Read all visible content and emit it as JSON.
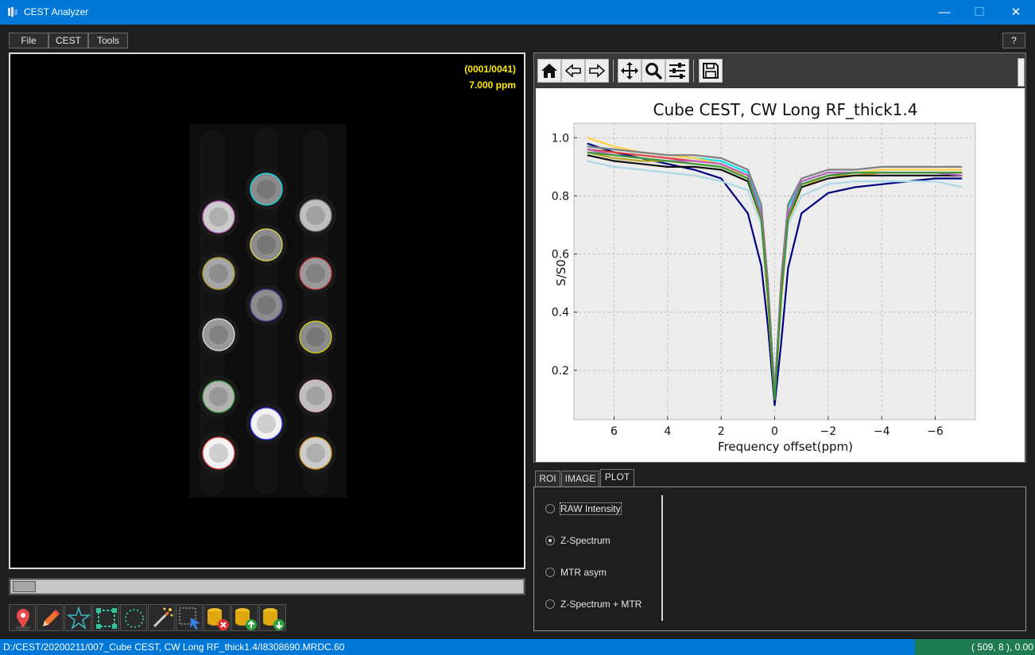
{
  "window": {
    "title": "CEST Analyzer",
    "minimize": "—",
    "maximize": "☐",
    "close": "✕"
  },
  "menu": {
    "file": "File",
    "cest": "CEST",
    "tools": "Tools",
    "help": "?"
  },
  "image_view": {
    "frame_counter": "(0001/0041)",
    "offset_label": "7.000 ppm"
  },
  "slider": {
    "position": 0.0,
    "frame": 1,
    "total": 41
  },
  "bottom_tools": [
    "roi-pin-icon",
    "pencil-icon",
    "star-polygon-icon",
    "square-roi-icon",
    "circle-roi-icon",
    "magic-wand-icon",
    "select-arrow-icon",
    "delete-roi-icon",
    "upload-roi-icon",
    "download-roi-icon"
  ],
  "plot_toolbar": [
    "home-icon",
    "back-icon",
    "forward-icon",
    "pan-icon",
    "zoom-icon",
    "configure-icon",
    "save-icon"
  ],
  "chart_data": {
    "type": "line",
    "title": "Cube CEST, CW Long RF_thick1.4",
    "xlabel": "Frequency offset(ppm)",
    "ylabel": "S/S0",
    "xlim": [
      7.5,
      -7.5
    ],
    "ylim": [
      0.03,
      1.05
    ],
    "x_inverted": true,
    "grid": true,
    "xticks": [
      "6",
      "4",
      "2",
      "0",
      "−2",
      "−4",
      "−6"
    ],
    "yticks": [
      "0.2",
      "0.4",
      "0.6",
      "0.8",
      "1.0"
    ],
    "x": [
      7,
      6,
      5,
      4,
      3,
      2,
      1,
      0.5,
      0.25,
      0,
      -0.25,
      -0.5,
      -1,
      -2,
      -3,
      -4,
      -5,
      -6,
      -7
    ],
    "series": [
      {
        "color": "#000080",
        "values": [
          0.98,
          0.95,
          0.93,
          0.91,
          0.89,
          0.86,
          0.74,
          0.56,
          0.35,
          0.08,
          0.3,
          0.55,
          0.74,
          0.81,
          0.83,
          0.84,
          0.85,
          0.86,
          0.86
        ]
      },
      {
        "color": "#00e5ee",
        "values": [
          0.97,
          0.96,
          0.95,
          0.94,
          0.93,
          0.92,
          0.88,
          0.75,
          0.5,
          0.12,
          0.52,
          0.76,
          0.85,
          0.88,
          0.88,
          0.88,
          0.88,
          0.88,
          0.87
        ]
      },
      {
        "color": "#ffd24a",
        "values": [
          1.0,
          0.97,
          0.95,
          0.94,
          0.93,
          0.91,
          0.86,
          0.7,
          0.42,
          0.1,
          0.44,
          0.7,
          0.83,
          0.87,
          0.88,
          0.89,
          0.89,
          0.89,
          0.89
        ]
      },
      {
        "color": "#add8e6",
        "values": [
          0.92,
          0.9,
          0.89,
          0.88,
          0.87,
          0.85,
          0.82,
          0.7,
          0.45,
          0.15,
          0.46,
          0.7,
          0.8,
          0.84,
          0.85,
          0.85,
          0.85,
          0.85,
          0.83
        ]
      },
      {
        "color": "#808080",
        "values": [
          0.97,
          0.96,
          0.95,
          0.94,
          0.94,
          0.93,
          0.89,
          0.77,
          0.5,
          0.12,
          0.52,
          0.77,
          0.86,
          0.89,
          0.89,
          0.9,
          0.9,
          0.9,
          0.9
        ]
      },
      {
        "color": "#e04040",
        "values": [
          0.96,
          0.95,
          0.94,
          0.93,
          0.92,
          0.91,
          0.87,
          0.74,
          0.47,
          0.11,
          0.48,
          0.74,
          0.84,
          0.87,
          0.88,
          0.88,
          0.88,
          0.88,
          0.88
        ]
      },
      {
        "color": "#b8a020",
        "values": [
          0.95,
          0.93,
          0.92,
          0.92,
          0.91,
          0.9,
          0.86,
          0.73,
          0.46,
          0.1,
          0.47,
          0.73,
          0.84,
          0.87,
          0.87,
          0.88,
          0.88,
          0.88,
          0.88
        ]
      },
      {
        "color": "#101010",
        "values": [
          0.94,
          0.92,
          0.91,
          0.9,
          0.9,
          0.89,
          0.85,
          0.72,
          0.45,
          0.1,
          0.46,
          0.72,
          0.83,
          0.86,
          0.87,
          0.87,
          0.87,
          0.87,
          0.87
        ]
      },
      {
        "color": "#c060c0",
        "values": [
          0.96,
          0.94,
          0.93,
          0.92,
          0.92,
          0.91,
          0.87,
          0.74,
          0.46,
          0.11,
          0.47,
          0.74,
          0.85,
          0.88,
          0.88,
          0.88,
          0.88,
          0.88,
          0.87
        ]
      },
      {
        "color": "#3a9a3a",
        "values": [
          0.95,
          0.94,
          0.93,
          0.92,
          0.91,
          0.9,
          0.86,
          0.72,
          0.45,
          0.1,
          0.46,
          0.72,
          0.84,
          0.87,
          0.88,
          0.88,
          0.88,
          0.88,
          0.88
        ]
      }
    ]
  },
  "tabs": {
    "roi": "ROI",
    "image": "IMAGE",
    "plot": "PLOT"
  },
  "plot_options": {
    "raw": "RAW Intensity",
    "z": "Z-Spectrum",
    "mtr": "MTR asym",
    "zmtr": "Z-Spectrum + MTR",
    "selected": "Z-Spectrum"
  },
  "status": {
    "path": "D:/CEST/20200211/007_Cube CEST, CW Long RF_thick1.4/I8308690.MRDC.60",
    "coords": "( 509,   8 ), 0.00"
  },
  "phantom": {
    "vials": [
      {
        "col": 0,
        "row": 1,
        "ring": "#c060c0",
        "brightness": 0.8
      },
      {
        "col": 0,
        "row": 2,
        "ring": "#b8a020",
        "brightness": 0.65
      },
      {
        "col": 0,
        "row": 3,
        "ring": "#e0e0e0",
        "brightness": 0.6
      },
      {
        "col": 0,
        "row": 4,
        "ring": "#3a9a3a",
        "brightness": 0.7
      },
      {
        "col": 0,
        "row": 5,
        "ring": "#e04040",
        "brightness": 0.95
      },
      {
        "col": 1,
        "row": 0,
        "ring": "#00e5ee",
        "brightness": 0.55
      },
      {
        "col": 1,
        "row": 1,
        "ring": "#e6e05a",
        "brightness": 0.55
      },
      {
        "col": 1,
        "row": 2,
        "ring": "#4a4aa0",
        "brightness": 0.55
      },
      {
        "col": 1,
        "row": 4,
        "ring": "#3030ff",
        "brightness": 0.95
      },
      {
        "col": 2,
        "row": 1,
        "ring": "#808080",
        "brightness": 0.75
      },
      {
        "col": 2,
        "row": 2,
        "ring": "#d04040",
        "brightness": 0.6
      },
      {
        "col": 2,
        "row": 3,
        "ring": "#e0d000",
        "brightness": 0.55
      },
      {
        "col": 2,
        "row": 4,
        "ring": "#e6b0c0",
        "brightness": 0.75
      },
      {
        "col": 2,
        "row": 5,
        "ring": "#e0a020",
        "brightness": 0.8
      }
    ]
  }
}
